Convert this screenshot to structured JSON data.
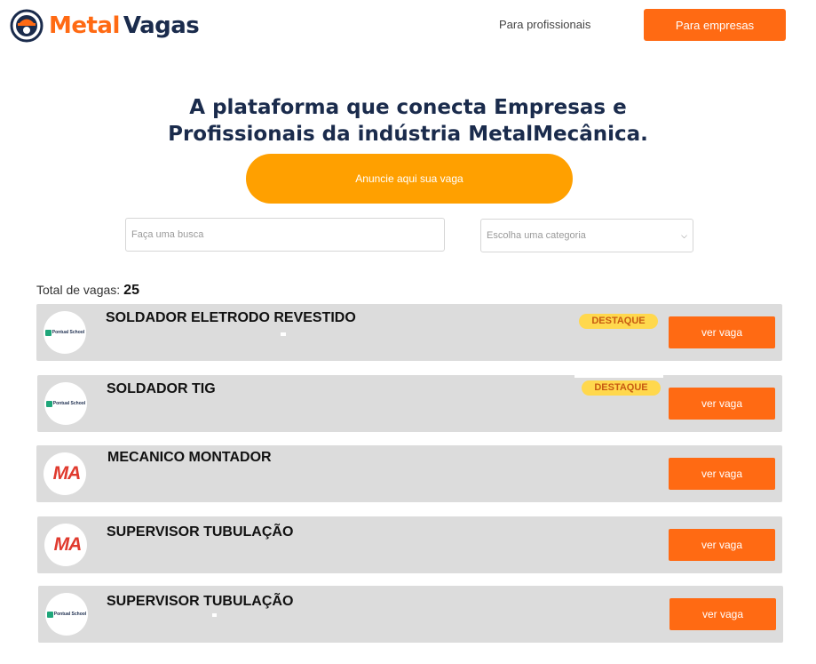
{
  "header": {
    "logo_metal": "Metal",
    "logo_vagas": "Vagas",
    "nav_professionals": "Para profissionais",
    "nav_companies": "Para empresas"
  },
  "hero": {
    "title_line1": "A plataforma que conecta Empresas e",
    "title_line2": "Profissionais da indústria  MetalMecânica.",
    "cta": "Anuncie aqui sua vaga"
  },
  "filters": {
    "search_placeholder": "Faça uma busca",
    "category_placeholder": "Escolha uma categoria"
  },
  "total": {
    "label": "Total de vagas:",
    "count": "25"
  },
  "jobs": [
    {
      "title": "SOLDADOR ELETRODO REVESTIDO",
      "company_logo": "Pontual School",
      "badge": "DESTAQUE",
      "button": "ver vaga"
    },
    {
      "title": "SOLDADOR TIG",
      "company_logo": "Pontual School",
      "badge": "DESTAQUE",
      "button": "ver vaga"
    },
    {
      "title": "MECANICO MONTADOR",
      "company_logo": "MA",
      "button": "ver vaga"
    },
    {
      "title": "SUPERVISOR TUBULAÇÃO",
      "company_logo": "MA",
      "button": "ver vaga"
    },
    {
      "title": "SUPERVISOR TUBULAÇÃO",
      "company_logo": "Pontual School",
      "button": "ver vaga"
    }
  ],
  "colors": {
    "brand_orange": "#ff6a13",
    "cta_amber": "#ffa000",
    "navy": "#1a2b4c",
    "badge_yellow": "#ffd84d",
    "card_gray": "#dcdcdc"
  }
}
